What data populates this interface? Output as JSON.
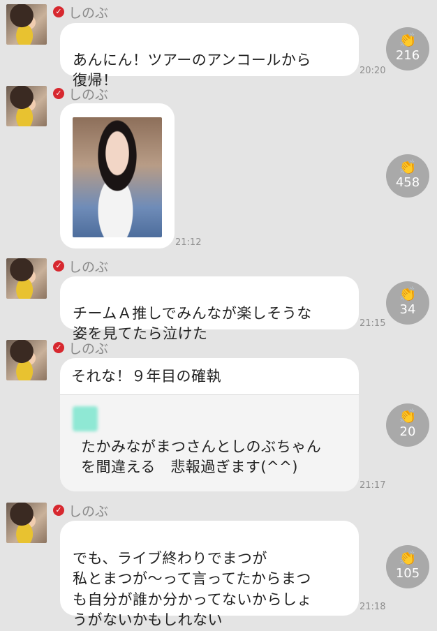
{
  "sender": "しのぶ",
  "messages": [
    {
      "text": "あんにん！ツアーのアンコールから\n復帰！",
      "time": "20:20",
      "likes": "216"
    },
    {
      "text": "",
      "time": "21:12",
      "likes": "458",
      "has_photo": true
    },
    {
      "text": "チームＡ推しでみんなが楽しそうな\n姿を見てたら泣けた",
      "time": "21:15",
      "likes": "34"
    },
    {
      "text": "それな！９年目の確執",
      "quote": "たかみながまつさんとしのぶちゃん\nを間違える　悲報過ぎます(^^)",
      "time": "21:17",
      "likes": "20"
    },
    {
      "text": "でも、ライブ終わりでまつが\n私とまつが〜って言ってたからまつ\nも自分が誰か分かってないからしょ\nうがないかもしれない",
      "time": "21:18",
      "likes": "105"
    }
  ],
  "icons": {
    "verified": "check-badge",
    "like": "clap-hands-icon"
  },
  "colors": {
    "background": "#e4e4e4",
    "bubble": "#ffffff",
    "badge": "#d7282f",
    "like": "#a9a9a9"
  }
}
